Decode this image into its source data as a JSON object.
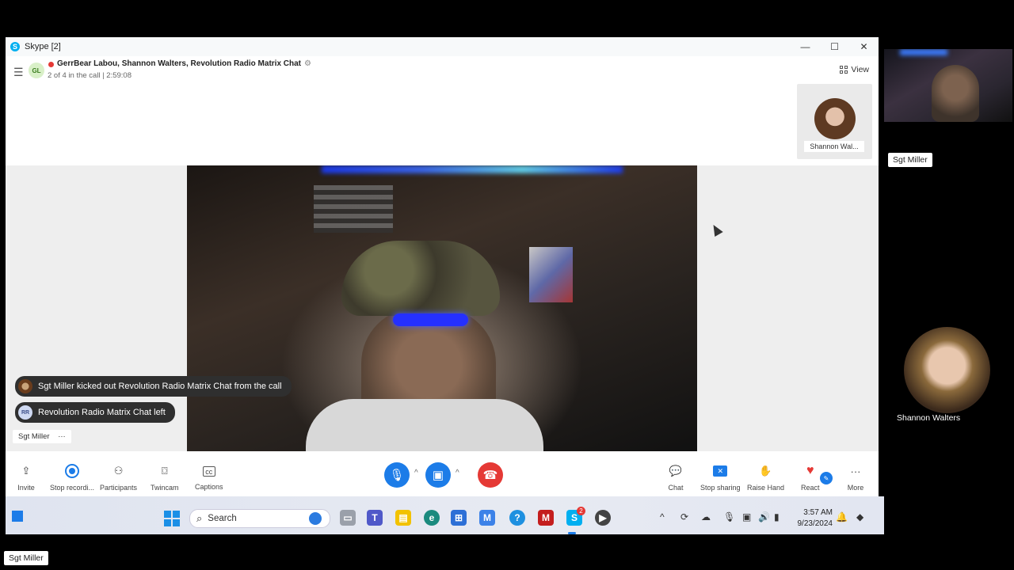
{
  "window": {
    "title": "Skype [2]",
    "controls": {
      "minimize": "—",
      "maximize": "☐",
      "close": "✕"
    }
  },
  "header": {
    "avatar_initials": "GL",
    "conversation_title": "GerrBear Labou, Shannon Walters, Revolution Radio Matrix Chat",
    "subtitle": "2 of 4 in the call | 2:59:08",
    "view_label": "View",
    "thumbnail_name": "Shannon Wal..."
  },
  "notifications": [
    {
      "avatar": "",
      "text": "Sgt Miller kicked out Revolution Radio Matrix Chat from the call"
    },
    {
      "avatar": "RR",
      "text": "Revolution Radio Matrix Chat left"
    }
  ],
  "presenter_tag": {
    "name": "Sgt Miller",
    "more": "···"
  },
  "toolbar": {
    "invite": "Invite",
    "stop_recording": "Stop recordi...",
    "participants": "Participants",
    "twincam": "Twincam",
    "captions": "Captions",
    "chat": "Chat",
    "stop_sharing": "Stop sharing",
    "raise_hand": "Raise Hand",
    "react": "React",
    "more": "More"
  },
  "taskbar": {
    "search_placeholder": "Search",
    "time": "3:57 AM",
    "date": "9/23/2024",
    "skype_badge": "2"
  },
  "right_panel": {
    "camera_label": "Sgt Miller",
    "participant_name": "Shannon Walters",
    "bottom_label": "Sgt Miller"
  },
  "colors": {
    "accent": "#1c7ce8",
    "hangup": "#e53935",
    "recording": "#e53935"
  }
}
